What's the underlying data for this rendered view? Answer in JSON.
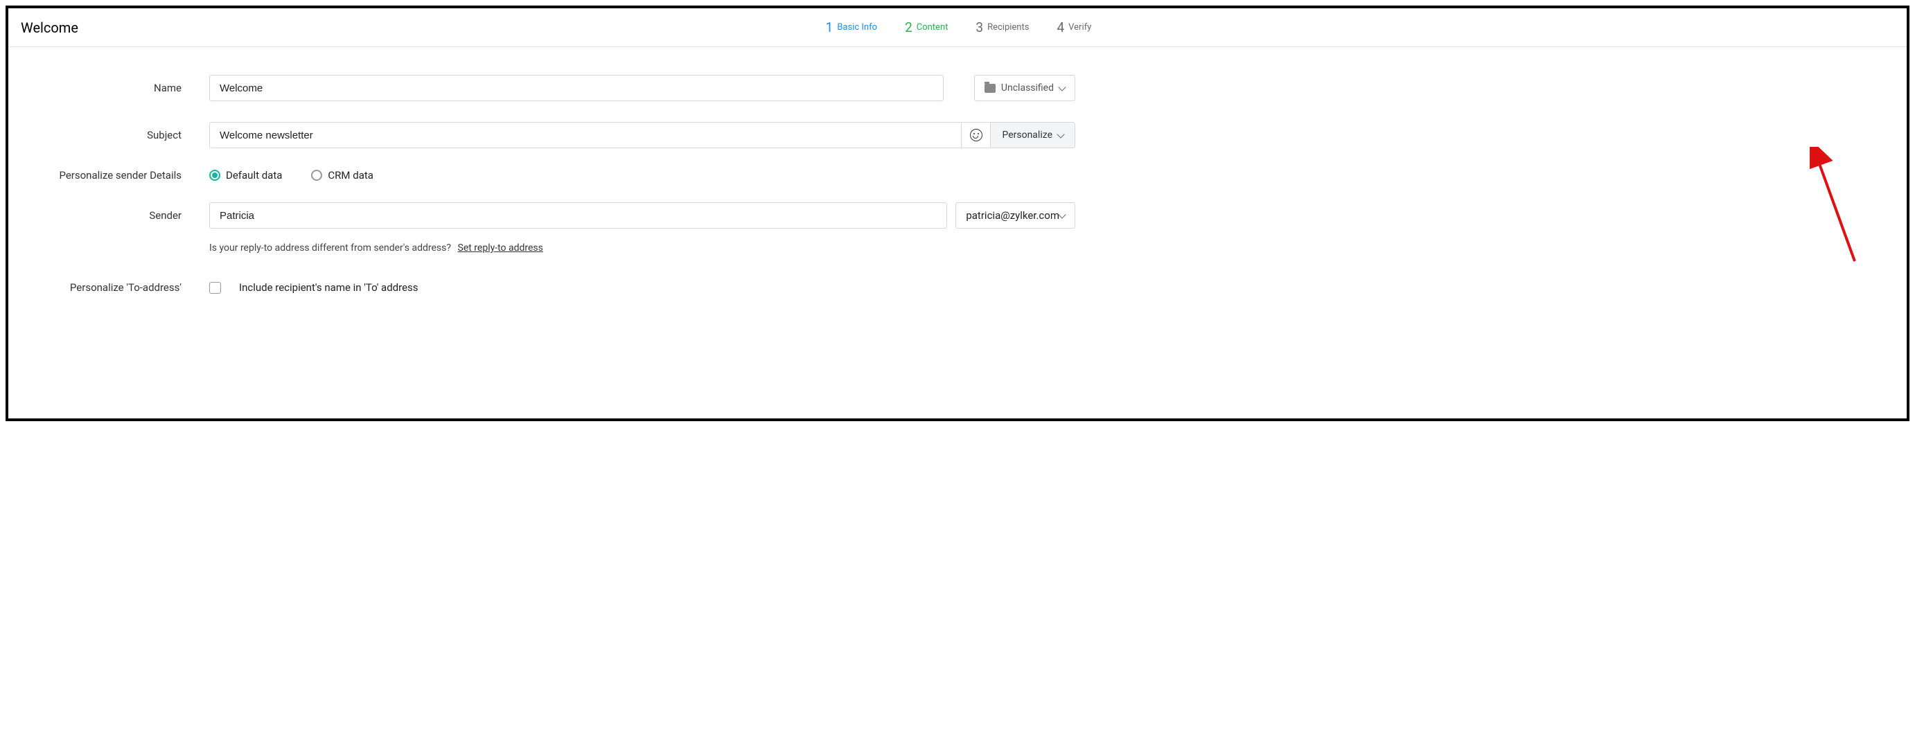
{
  "header": {
    "title": "Welcome",
    "steps": [
      {
        "num": "1",
        "label": "Basic Info",
        "state": "active"
      },
      {
        "num": "2",
        "label": "Content",
        "state": "done"
      },
      {
        "num": "3",
        "label": "Recipients",
        "state": ""
      },
      {
        "num": "4",
        "label": "Verify",
        "state": ""
      }
    ]
  },
  "form": {
    "name_label": "Name",
    "name_value": "Welcome",
    "tag_label": "Unclassified",
    "subject_label": "Subject",
    "subject_value": "Welcome newsletter",
    "personalize_btn": "Personalize",
    "sender_details_label": "Personalize sender Details",
    "radio_default": "Default data",
    "radio_crm": "CRM data",
    "sender_label": "Sender",
    "sender_name": "Patricia",
    "sender_email": "patricia@zylker.com",
    "reply_q": "Is your reply-to address different from sender's address?",
    "reply_link": "Set reply-to address",
    "to_addr_label": "Personalize 'To-address'",
    "to_addr_checkbox": "Include recipient's name in 'To' address"
  }
}
